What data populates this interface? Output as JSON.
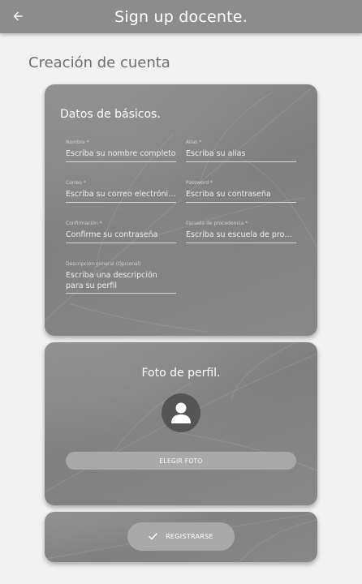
{
  "appbar": {
    "title": "Sign up docente.",
    "back_icon": "arrow-left-icon"
  },
  "page": {
    "heading": "Creación de cuenta"
  },
  "datos": {
    "title": "Datos de básicos.",
    "fields": {
      "nombre": {
        "label": "Nombre *",
        "placeholder": "Escriba su nombre completo"
      },
      "alias": {
        "label": "Alias *",
        "placeholder": "Escriba su alias"
      },
      "correo": {
        "label": "Correo *",
        "placeholder": "Escriba su correo electrónico"
      },
      "password": {
        "label": "Password *",
        "placeholder": "Escriba su contraseña"
      },
      "confirmacion": {
        "label": "Confirmación *",
        "placeholder": "Confirme su contraseña"
      },
      "escuela": {
        "label": "Escuela de procedencia *",
        "placeholder": "Escriba su escuela de procedencia"
      },
      "descripcion": {
        "label": "Descripción general (Opcional)",
        "placeholder": "Escriba una descripción para su perfil"
      }
    }
  },
  "foto": {
    "title": "Foto de perfil.",
    "avatar_icon": "person-icon",
    "button_label": "ELEGIR FOTO"
  },
  "registro": {
    "button_label": "REGISTRARSE",
    "check_icon": "check-icon"
  },
  "colors": {
    "appbar": "#8c8c8c",
    "card": "#868686",
    "button": "#a9a9a9",
    "avatar_bg": "#555555"
  }
}
